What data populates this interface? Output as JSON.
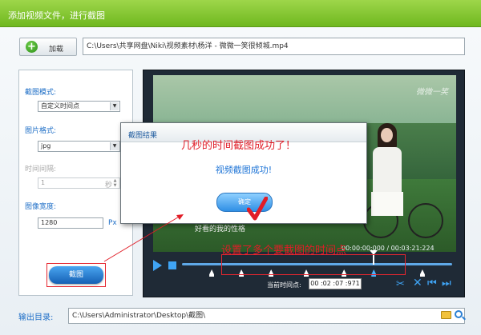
{
  "window": {
    "title": "添加视频文件，进行截图"
  },
  "toolbar": {
    "add_label": "加载",
    "file_path": "C:\\Users\\共享网盘\\Niki\\视频素材\\杨洋 - 微微一笑很倾城.mp4"
  },
  "settings": {
    "mode_label": "截图模式:",
    "mode_value": "自定义时间点",
    "format_label": "图片格式:",
    "format_value": "jpg",
    "interval_label": "时间间隔:",
    "interval_value": "1",
    "interval_unit": "秒",
    "width_label": "图像宽度:",
    "width_value": "1280",
    "width_unit": "Px",
    "capture_label": "截图"
  },
  "player": {
    "watermark": "微微一笑",
    "subtitle": "好看的我的性格",
    "timecode": "00:00:00:000 / 00:03:21:224",
    "current_time_label": "当前时间点:",
    "current_time_value": "00 :02 :07 :971",
    "marker_positions": [
      0.11,
      0.22,
      0.33,
      0.46,
      0.6,
      0.71,
      0.89
    ],
    "active_marker_index": 5,
    "cursor_position": 0.71
  },
  "dialog": {
    "title": "截图结果",
    "message": "视频截图成功!",
    "ok_label": "确定"
  },
  "annotations": {
    "top": "几秒的时间截图成功了！",
    "bottom": "设置了多个要截图的时间点"
  },
  "output": {
    "label": "输出目录:",
    "path": "C:\\Users\\Administrator\\Desktop\\截图\\"
  },
  "colors": {
    "accent_green": "#7cc42a",
    "accent_blue": "#1f6fc7",
    "annotation_red": "#e11d27"
  }
}
